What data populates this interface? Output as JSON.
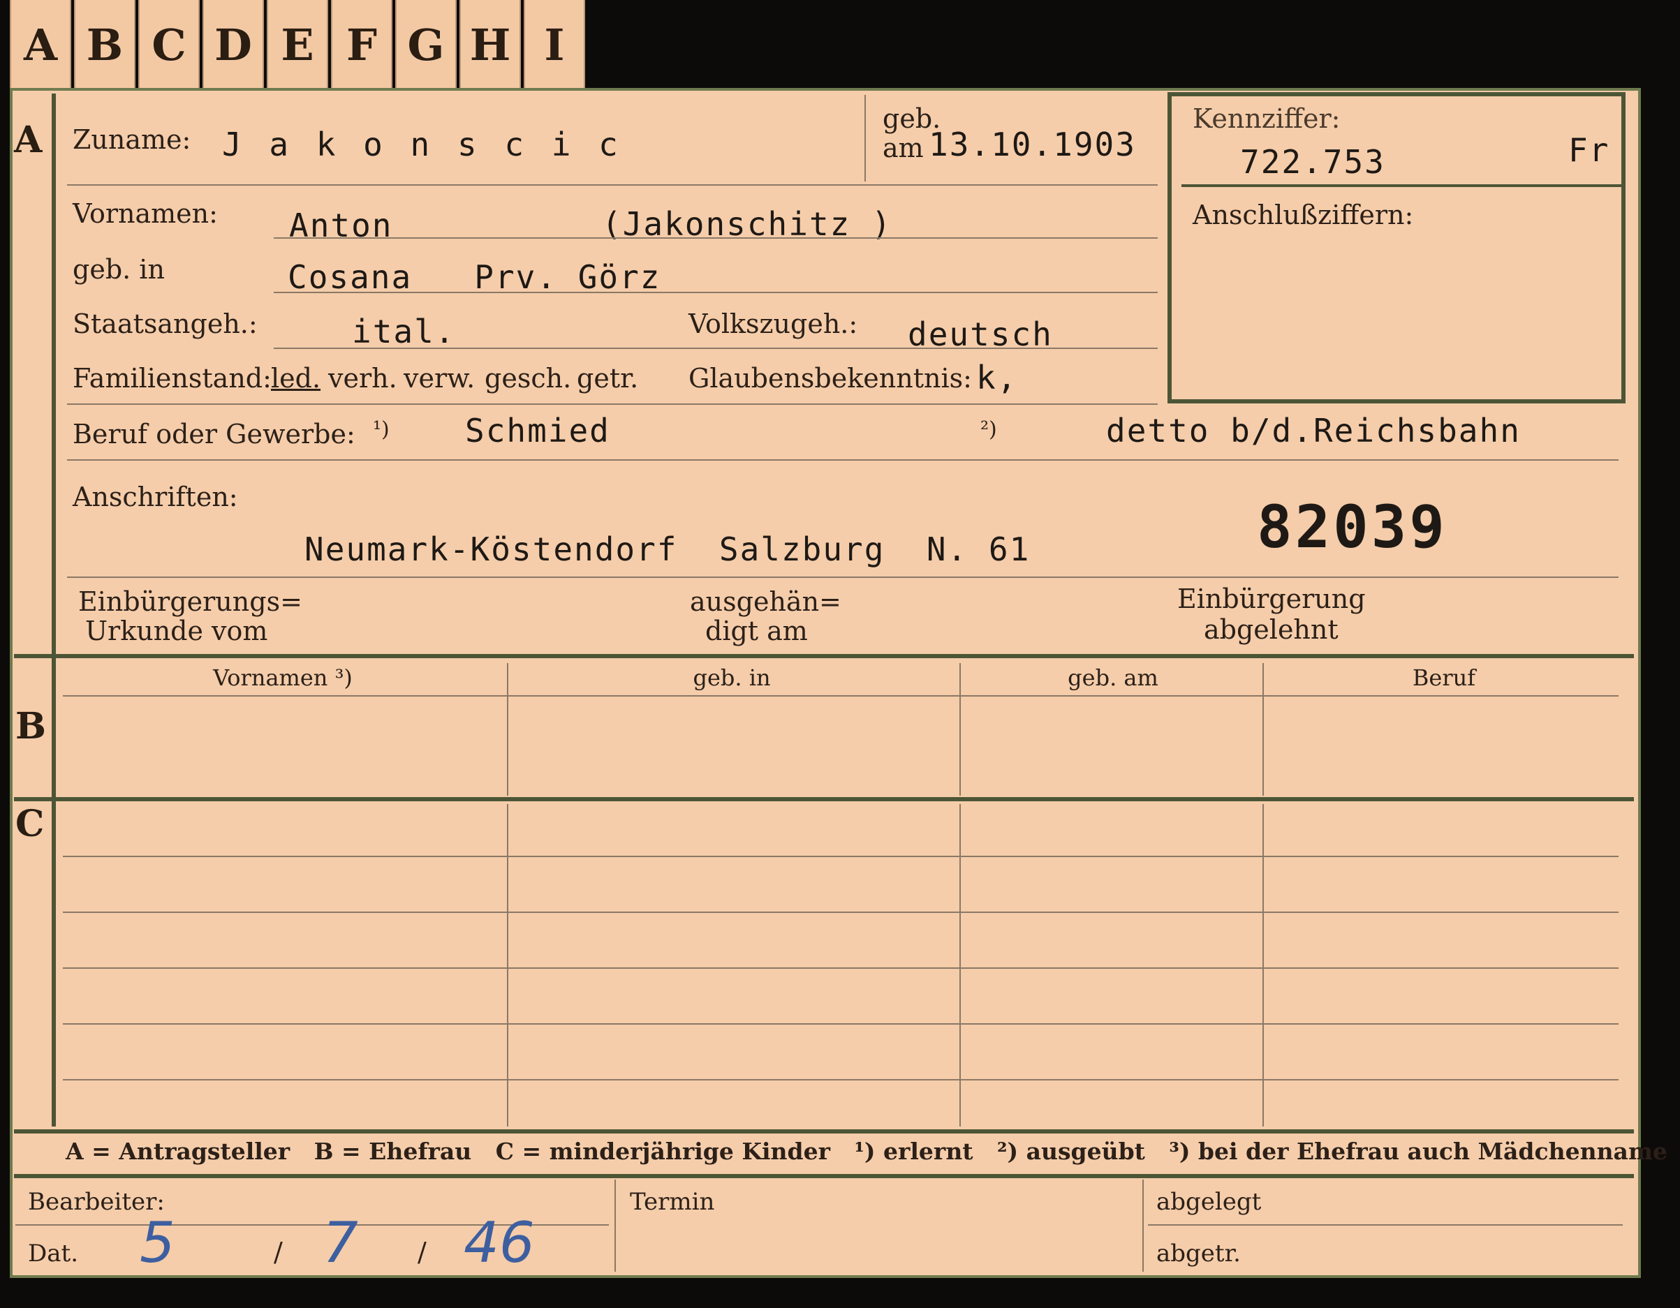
{
  "tabs": [
    "A",
    "B",
    "C",
    "D",
    "E",
    "F",
    "G",
    "H",
    "I"
  ],
  "sections": {
    "a": "A",
    "b": "B",
    "c": "C"
  },
  "labels": {
    "zuname": "Zuname:",
    "geb": "geb.",
    "geb_am": "am",
    "vornamen": "Vornamen:",
    "geb_in": "geb. in",
    "staatsangeh": "Staatsangeh.:",
    "volkszugeh": "Volkszugeh.:",
    "familienstand": "Familienstand:",
    "familienstand_opts": [
      "led.",
      "verh.",
      "verw.",
      "gesch.",
      "getr."
    ],
    "glaubensbekenntnis": "Glaubensbekenntnis:",
    "beruf": "Beruf oder Gewerbe:",
    "beruf_fn1": "¹)",
    "beruf_fn2": "²)",
    "anschriften": "Anschriften:",
    "einbuerg1": "Einbürgerungs=",
    "einbuerg2": "Urkunde vom",
    "ausgeh1": "ausgehän=",
    "ausgeh2": "digt am",
    "einb_abgel1": "Einbürgerung",
    "einb_abgel2": "abgelehnt",
    "kennziffer": "Kennziffer:",
    "anschlussziffern": "Anschlußziffern:",
    "bearbeiter": "Bearbeiter:",
    "dat": "Dat.",
    "termin": "Termin",
    "abgelegt": "abgelegt",
    "abgetr": "abgetr."
  },
  "values": {
    "zuname": "J a k o n s c i c",
    "geb_datum": "13.10.1903",
    "vornamen": "Anton",
    "alias": "(Jakonschitz )",
    "geb_ort": "Cosana   Prv. Görz",
    "staatsangeh": "ital.",
    "volkszugeh": "deutsch",
    "glaube": "k,",
    "beruf1": "Schmied",
    "beruf2": "detto b/d.Reichsbahn",
    "anschrift": "Neumark-Köstendorf  Salzburg  N. 61",
    "nummer": "82039",
    "kennziffer": "722.753",
    "kennziffer_suffix": "Fr",
    "dat_tag": "5",
    "dat_monat": "7",
    "dat_jahr": "46",
    "slash": "/"
  },
  "table_b": {
    "headers": [
      "Vornamen ³)",
      "geb. in",
      "geb. am",
      "Beruf"
    ]
  },
  "legend": "A = Antragsteller   B = Ehefrau   C = minderjährige Kinder   ¹) erlernt   ²) ausgeübt   ³) bei der Ehefrau auch Mädchenname",
  "colors": {
    "card": "#f5cdaa",
    "frame": "#4d5537",
    "ink": "#2c2018",
    "handwriting": "#3d5fa0"
  }
}
